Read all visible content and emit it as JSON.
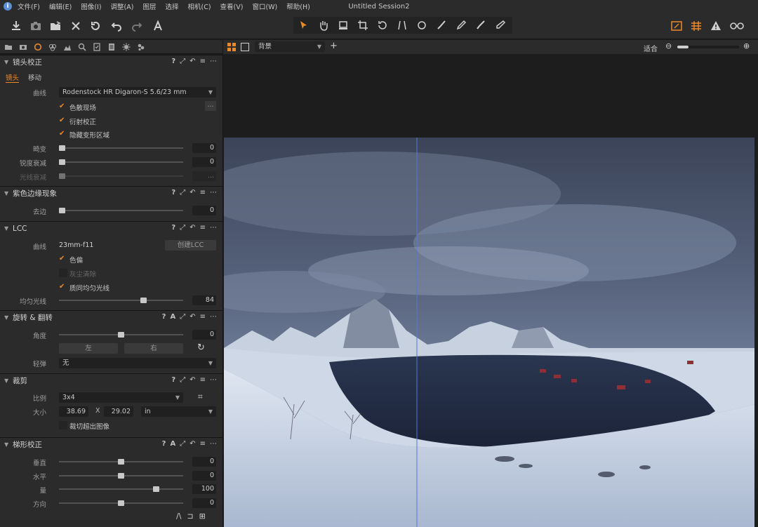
{
  "window": {
    "title": "Untitled Session2"
  },
  "menu": [
    "文件(F)",
    "编辑(E)",
    "图像(I)",
    "调整(A)",
    "图层",
    "选择",
    "相机(C)",
    "查看(V)",
    "窗口(W)",
    "帮助(H)"
  ],
  "viewer": {
    "layout_select": "背景",
    "fit_label": "适合"
  },
  "lens": {
    "title": "镜头校正",
    "tabs": [
      "镜头",
      "移动"
    ],
    "profile_label": "曲线",
    "profile_value": "Rodenstock HR Digaron-S 5.6/23 mm",
    "checks": [
      {
        "label": "色散现场",
        "checked": true
      },
      {
        "label": "衍射校正",
        "checked": true
      },
      {
        "label": "隐藏变形区域",
        "checked": true
      }
    ],
    "more_button": "...",
    "sliders": [
      {
        "label": "畸变",
        "value": "0",
        "pos": 0.0
      },
      {
        "label": "锐度衰减",
        "value": "0",
        "pos": 0.0
      },
      {
        "label": "光线衰减",
        "value": "...",
        "pos": 0.0
      }
    ]
  },
  "chroma": {
    "title": "紫色边缘现象",
    "slider": {
      "label": "去边",
      "value": "0",
      "pos": 0.0
    }
  },
  "lcc": {
    "title": "LCC",
    "profile_label": "曲线",
    "profile_value": "23mm-f11",
    "create_button": "创建LCC",
    "checks": [
      {
        "label": "色偏",
        "checked": true
      },
      {
        "label": "灰尘清除",
        "checked": false
      },
      {
        "label": "质同均匀光线",
        "checked": true
      }
    ],
    "slider": {
      "label": "均匀光线",
      "value": "84",
      "pos": 0.69
    }
  },
  "rotation": {
    "title": "旋转 & 翻转",
    "slider": {
      "label": "角度",
      "value": "0",
      "pos": 0.5
    },
    "left_button": "左",
    "right_button": "右",
    "flip_label": "轻弹",
    "flip_value": "无"
  },
  "crop": {
    "title": "裁剪",
    "ratio_label": "比例",
    "ratio_value": "3x4",
    "size_label": "大小",
    "width": "38.69",
    "x_sep": "X",
    "height": "29.02",
    "unit": "in",
    "outside_label": "裁切超出图像"
  },
  "keystone": {
    "title": "梯形校正",
    "sliders": [
      {
        "label": "垂直",
        "value": "0",
        "pos": 0.5
      },
      {
        "label": "水平",
        "value": "0",
        "pos": 0.5
      },
      {
        "label": "量",
        "value": "100",
        "pos": 0.8
      },
      {
        "label": "方向",
        "value": "0",
        "pos": 0.5
      }
    ]
  },
  "colors": {
    "accent": "#ec8a2a",
    "guide": "#5577dd"
  }
}
